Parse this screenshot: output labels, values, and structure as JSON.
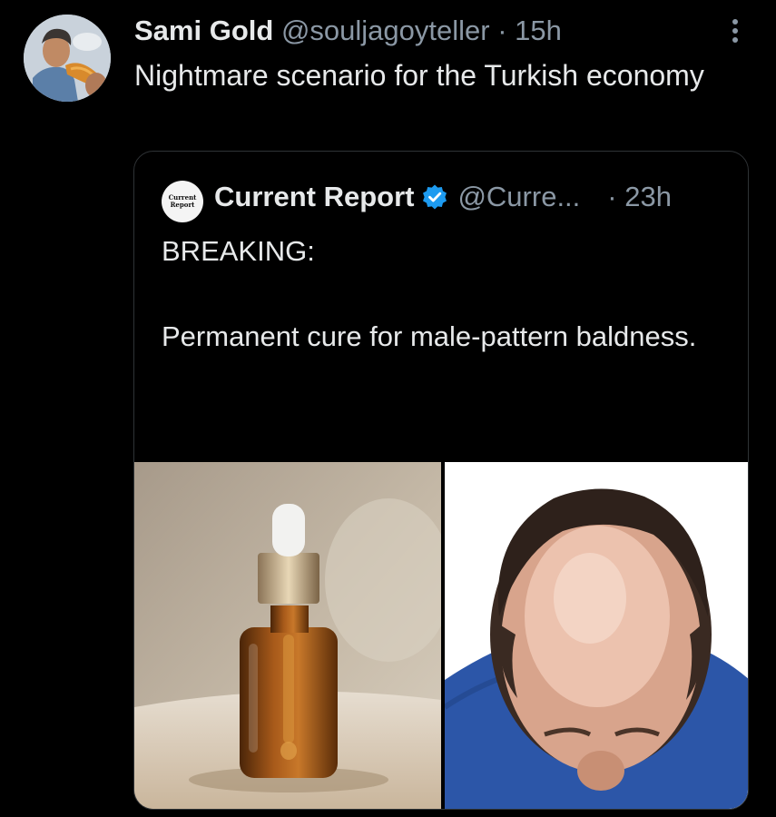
{
  "tweet": {
    "author_name": "Sami Gold",
    "author_handle": "@souljagoyteller",
    "separator": " · ",
    "time": "15h",
    "text": "Nightmare scenario for the Turkish economy",
    "more_icon": "more-vertical-icon"
  },
  "quote": {
    "logo_line1": "Current",
    "logo_line2": "Report",
    "author_name": "Current Report",
    "verified_icon": "verified-badge-icon",
    "verified_color": "#1d9bf0",
    "author_handle": "@Curre...",
    "time": "· 23h",
    "text_line1": "BREAKING:",
    "text_line2": "Permanent cure for male-pattern baldness.",
    "ellipsis": "...",
    "media": [
      "serum-bottle-photo",
      "balding-head-photo"
    ]
  },
  "colors": {
    "background": "#000000",
    "text_primary": "#e7e9ea",
    "text_secondary": "#8b98a5",
    "border": "#2f3336"
  }
}
